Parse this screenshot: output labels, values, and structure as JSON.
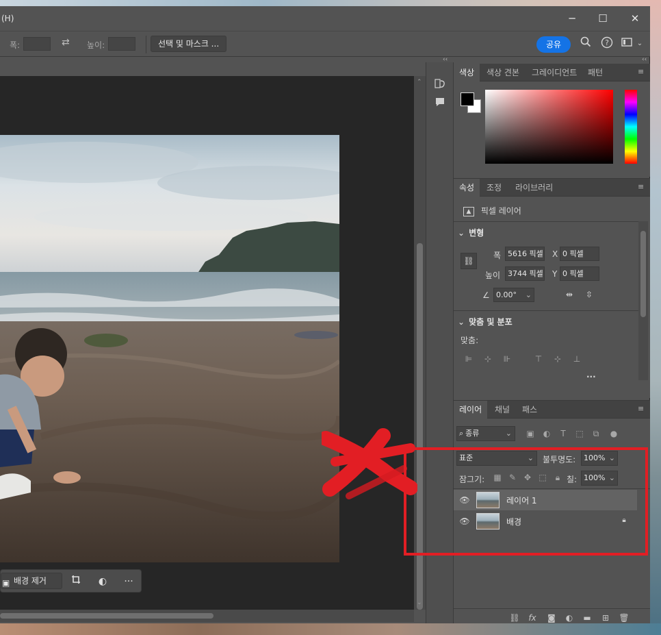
{
  "window": {
    "title_fragment": "(H)",
    "controls": {
      "minimize": "─",
      "maximize": "☐",
      "close": "✕"
    }
  },
  "options_bar": {
    "width_label": "폭:",
    "swap_icon": "⇄",
    "height_label": "높이:",
    "select_mask_button": "선택 및 마스크 ...",
    "share_button": "공유",
    "icons": [
      "search-icon",
      "help-icon",
      "workspace-icon"
    ]
  },
  "taskbar": {
    "remove_bg_button": "배경 제거",
    "more": "···"
  },
  "panels": {
    "collapse": "‹‹",
    "color": {
      "tabs": [
        "색상",
        "색상 견본",
        "그레이디언트",
        "패턴"
      ],
      "active_tab": 0,
      "foreground": "#000000",
      "background": "#ffffff"
    },
    "properties": {
      "tabs": [
        "속성",
        "조정",
        "라이브러리"
      ],
      "active_tab": 0,
      "layer_type": "픽셀 레이어",
      "transform": {
        "title": "변형",
        "width_label": "폭",
        "width_value": "5616 픽셀",
        "x_label": "X",
        "x_value": "0 픽셀",
        "height_label": "높이",
        "height_value": "3744 픽셀",
        "y_label": "Y",
        "y_value": "0 픽셀",
        "angle_value": "0.00°"
      },
      "align": {
        "title": "맞춤 및 분포",
        "label": "맞춤:",
        "more": "···"
      }
    },
    "layers": {
      "tabs": [
        "레이어",
        "채널",
        "패스"
      ],
      "active_tab": 0,
      "filter_kind": "종류",
      "blend_mode": "표준",
      "opacity_label": "불투명도:",
      "opacity_value": "100%",
      "lock_label": "잠그기:",
      "fill_label": "칠:",
      "fill_value": "100%",
      "items": [
        {
          "name": "레이어 1",
          "visible": true,
          "selected": true,
          "locked": false
        },
        {
          "name": "배경",
          "visible": true,
          "selected": false,
          "locked": true
        }
      ],
      "fx_label": "fx"
    }
  },
  "annotation": {
    "color": "#e21e24"
  }
}
